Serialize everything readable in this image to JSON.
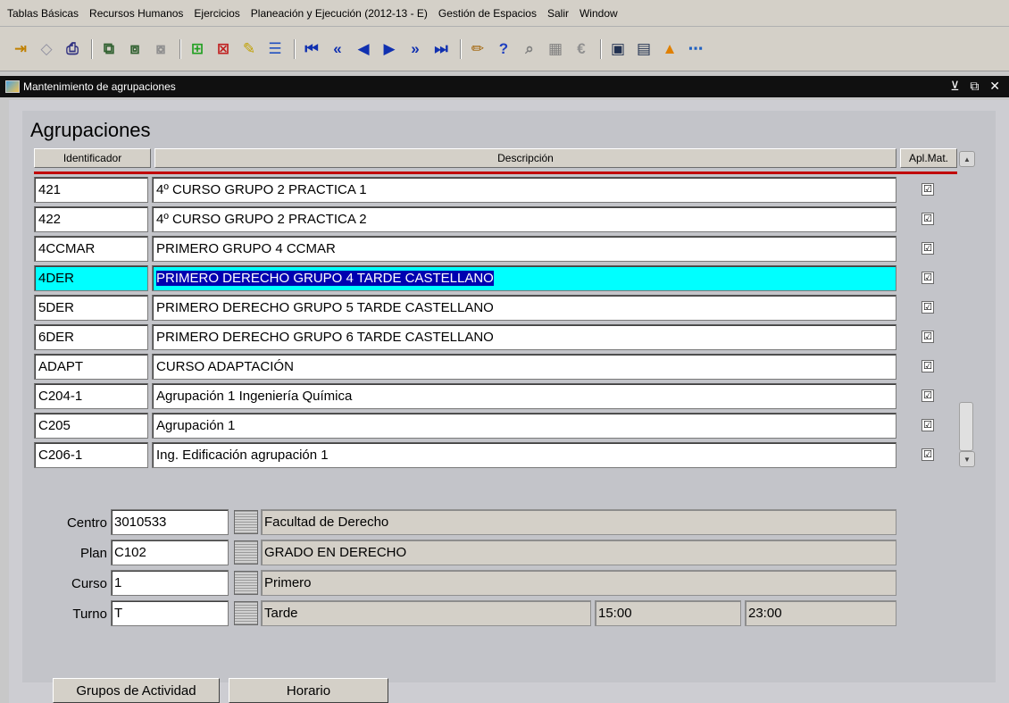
{
  "menu": [
    "Tablas Básicas",
    "Recursos Humanos",
    "Ejercicios",
    "Planeación y Ejecución (2012-13 - E)",
    "Gestión de Espacios",
    "Salir",
    "Window"
  ],
  "toolbar": {
    "icons": [
      "exit-icon",
      "clear-icon",
      "print-icon",
      "copy-record-icon",
      "copy-field-icon",
      "clear-field-icon",
      "insert-record-icon",
      "delete-record-icon",
      "edit-icon",
      "list-icon",
      "first-icon",
      "prev-block-icon",
      "prev-record-icon",
      "next-record-icon",
      "next-block-icon",
      "last-icon",
      "pencil-icon",
      "help-icon",
      "query-icon",
      "calendar-icon",
      "euro-icon",
      "save-icon",
      "save-exit-icon",
      "warning-icon",
      "link-icon"
    ]
  },
  "window": {
    "title": "Mantenimiento de agrupaciones",
    "controls": "⊻ ⧉ ✕"
  },
  "form": {
    "title": "Agrupaciones",
    "headers": {
      "id": "Identificador",
      "desc": "Descripción",
      "apl": "Apl.Mat."
    },
    "rows": [
      {
        "id": "421",
        "desc": "4º CURSO GRUPO 2 PRACTICA 1",
        "apl": "☑"
      },
      {
        "id": "422",
        "desc": "4º CURSO GRUPO 2 PRACTICA 2",
        "apl": "☑"
      },
      {
        "id": "4CCMAR",
        "desc": "PRIMERO GRUPO 4 CCMAR",
        "apl": "☑"
      },
      {
        "id": "4DER",
        "desc": "PRIMERO DERECHO GRUPO 4 TARDE CASTELLANO",
        "apl": "☑"
      },
      {
        "id": "5DER",
        "desc": "PRIMERO DERECHO GRUPO 5 TARDE CASTELLANO",
        "apl": "☑"
      },
      {
        "id": "6DER",
        "desc": "PRIMERO DERECHO GRUPO 6 TARDE CASTELLANO",
        "apl": "☑"
      },
      {
        "id": "ADAPT",
        "desc": "CURSO ADAPTACIÓN",
        "apl": "☑"
      },
      {
        "id": "C204-1",
        "desc": "Agrupación 1 Ingeniería Química",
        "apl": "☑"
      },
      {
        "id": "C205",
        "desc": "Agrupación 1",
        "apl": "☑"
      },
      {
        "id": "C206-1",
        "desc": "Ing. Edificación agrupación 1",
        "apl": "☑"
      }
    ],
    "selected_index": 3
  },
  "details": {
    "centro": {
      "label": "Centro",
      "code": "3010533",
      "desc": "Facultad de Derecho"
    },
    "plan": {
      "label": "Plan",
      "code": "C102",
      "desc": "GRADO EN DERECHO"
    },
    "curso": {
      "label": "Curso",
      "code": "1",
      "desc": "Primero"
    },
    "turno": {
      "label": "Turno",
      "code": "T",
      "desc": "Tarde",
      "start": "15:00",
      "end": "23:00"
    }
  },
  "buttons": {
    "grupos": "Grupos de Actividad",
    "horario": "Horario"
  },
  "colors": {
    "selected_row": "#00ffff",
    "selected_text_bg": "#0000b0",
    "header_underline": "#c00000",
    "title_bar": "#101010"
  }
}
